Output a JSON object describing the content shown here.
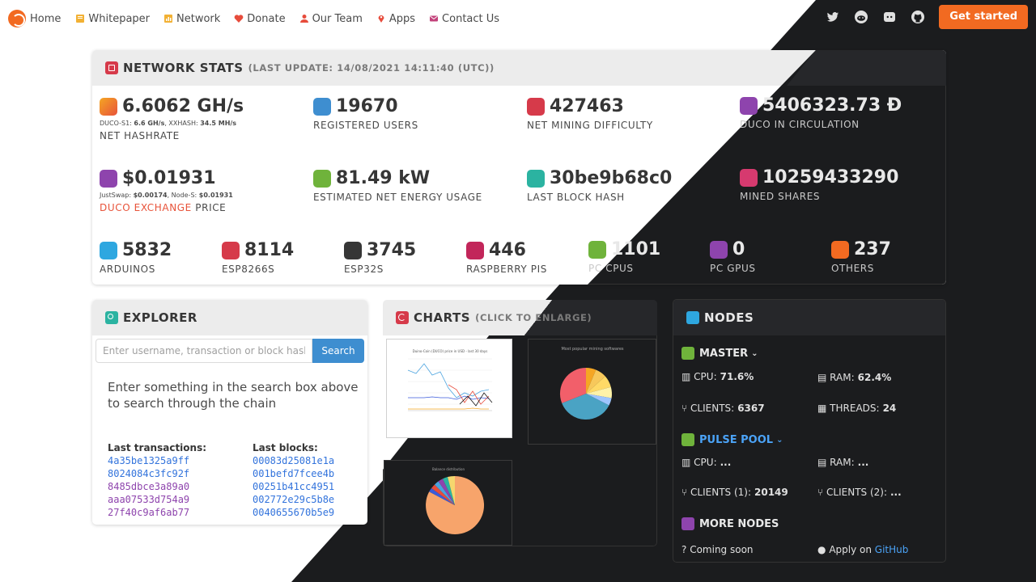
{
  "nav": {
    "items": [
      {
        "label": "Home"
      },
      {
        "label": "Whitepaper"
      },
      {
        "label": "Network"
      },
      {
        "label": "Donate"
      },
      {
        "label": "Our Team"
      },
      {
        "label": "Apps"
      },
      {
        "label": "Contact Us"
      }
    ],
    "cta": "Get started",
    "social": [
      "twitter-icon",
      "reddit-icon",
      "discord-icon",
      "github-icon"
    ]
  },
  "stats": {
    "title": "NETWORK STATS",
    "last_update": "(LAST UPDATE: 14/08/2021 14:11:40 (UTC))",
    "hashrate": {
      "value": "6.6062 GH/s",
      "detail_a": "DUCO-S1:",
      "detail_a_val": "6.6 GH/s",
      "detail_b": ", XXHASH:",
      "detail_b_val": "34.5 MH/s",
      "label": "NET HASHRATE"
    },
    "users": {
      "value": "19670",
      "label": "REGISTERED USERS"
    },
    "difficulty": {
      "value": "427463",
      "label": "NET MINING DIFFICULTY"
    },
    "circulation": {
      "value": "5406323.73 Ð",
      "label": "DUCO IN CIRCULATION"
    },
    "price": {
      "value": "$0.01931",
      "detail_a": "JustSwap:",
      "detail_a_val": "$0.00174",
      "detail_b": ", Node-S:",
      "detail_b_val": "$0.01931",
      "label_link": "DUCO EXCHANGE",
      "label_rest": " PRICE"
    },
    "energy": {
      "value": "81.49 kW",
      "label": "ESTIMATED NET ENERGY USAGE"
    },
    "block_hash": {
      "value": "30be9b68c0",
      "label": "LAST BLOCK HASH"
    },
    "shares": {
      "value": "10259433290",
      "label": "MINED SHARES"
    },
    "arduinos": {
      "value": "5832",
      "label": "ARDUINOS"
    },
    "esp8266": {
      "value": "8114",
      "label": "ESP8266S"
    },
    "esp32": {
      "value": "3745",
      "label": "ESP32S"
    },
    "rpi": {
      "value": "446",
      "label": "RASPBERRY PIS"
    },
    "pc_cpus": {
      "value": "1101",
      "label": "PC CPUS"
    },
    "pc_gpus": {
      "value": "0",
      "label": "PC GPUS"
    },
    "others": {
      "value": "237",
      "label": "OTHERS"
    }
  },
  "explorer": {
    "title": "EXPLORER",
    "placeholder": "Enter username, transaction or block hash",
    "search_label": "Search",
    "message": "Enter something in the search box above to search through the chain",
    "tx_header": "Last transactions:",
    "blocks_header": "Last blocks:",
    "transactions": [
      "4a35be1325a9ff",
      "8024084c3fc92f",
      "8485dbce3a89a0",
      "aaa07533d754a9",
      "27f40c9af6ab77"
    ],
    "blocks": [
      "00083d25081e1a",
      "001befd7fcee4b",
      "00251b41cc4951",
      "002772e29c5b8e",
      "0040655670b5e9"
    ]
  },
  "charts": {
    "title": "CHARTS",
    "subtitle": "(CLICK TO ENLARGE)",
    "thumb1_title": "Duino-Coin (DUCO) price in USD - last 30 days",
    "thumb2_title": "Most popular mining softwares",
    "thumb3_title": "Balance distribution"
  },
  "nodes": {
    "title": "NODES",
    "master": {
      "name": "MASTER",
      "cpu_label": "CPU:",
      "cpu": "71.6%",
      "ram_label": "RAM:",
      "ram": "62.4%",
      "clients_label": "CLIENTS:",
      "clients": "6367",
      "threads_label": "THREADS:",
      "threads": "24"
    },
    "pulse": {
      "name": "PULSE POOL",
      "cpu_label": "CPU:",
      "cpu": "...",
      "ram_label": "RAM:",
      "ram": "...",
      "clients1_label": "CLIENTS (1):",
      "clients1": "20149",
      "clients2_label": "CLIENTS (2):",
      "clients2": "..."
    },
    "more": {
      "name": "MORE NODES",
      "coming": "Coming soon",
      "apply_prefix": "Apply on",
      "apply_link": "GitHub"
    }
  },
  "colors": {
    "accent": "#f26a21",
    "link": "#3273dc",
    "dark_bg": "#1b1c1e",
    "node_link": "#4ba3f7",
    "search_btn": "#3e8ed0"
  }
}
